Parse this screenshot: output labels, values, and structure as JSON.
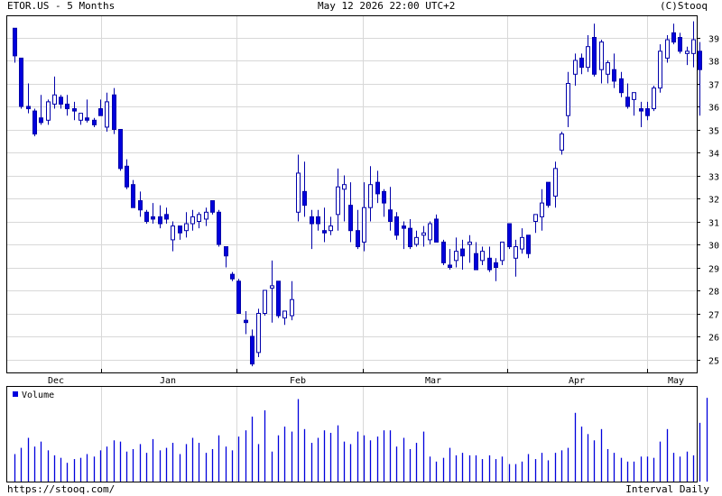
{
  "header": {
    "ticker_label": "ETOR.US - 5 Months",
    "datetime": "May 12 2026 22:00 UTC+2",
    "copyright": "(C)Stooq"
  },
  "footer": {
    "source_url": "https://stooq.com/",
    "interval": "Interval Daily"
  },
  "colors": {
    "bull": "#ffffff",
    "bear": "#0000dd",
    "outline": "#0000aa",
    "volume": "#0000dd",
    "grid": "#d8d8d8"
  },
  "chart_data": [
    {
      "type": "candlestick",
      "ylim": [
        24.3,
        39.7
      ],
      "y_ticks": [
        25,
        26,
        27,
        28,
        29,
        30,
        31,
        32,
        33,
        34,
        35,
        36,
        37,
        38,
        39
      ],
      "x_labels": [
        "Dec",
        "Jan",
        "Feb",
        "Mar",
        "Apr",
        "May"
      ],
      "candles": [
        {
          "o": 39.4,
          "h": 39.4,
          "l": 37.9,
          "c": 38.2
        },
        {
          "o": 38.1,
          "h": 38.1,
          "l": 35.9,
          "c": 36.0
        },
        {
          "o": 36.0,
          "h": 37.0,
          "l": 35.7,
          "c": 35.9
        },
        {
          "o": 35.8,
          "h": 35.9,
          "l": 34.7,
          "c": 34.8
        },
        {
          "o": 35.5,
          "h": 36.5,
          "l": 35.2,
          "c": 35.3
        },
        {
          "o": 35.4,
          "h": 36.3,
          "l": 35.2,
          "c": 36.2
        },
        {
          "o": 36.1,
          "h": 37.3,
          "l": 35.9,
          "c": 36.5
        },
        {
          "o": 36.4,
          "h": 36.5,
          "l": 35.9,
          "c": 36.1
        },
        {
          "o": 36.1,
          "h": 36.5,
          "l": 35.6,
          "c": 35.9
        },
        {
          "o": 35.9,
          "h": 36.2,
          "l": 35.4,
          "c": 35.8
        },
        {
          "o": 35.4,
          "h": 35.7,
          "l": 35.2,
          "c": 35.7
        },
        {
          "o": 35.5,
          "h": 36.3,
          "l": 35.3,
          "c": 35.4
        },
        {
          "o": 35.4,
          "h": 35.5,
          "l": 35.1,
          "c": 35.2
        },
        {
          "o": 35.9,
          "h": 36.3,
          "l": 35.6,
          "c": 35.6
        },
        {
          "o": 35.1,
          "h": 36.6,
          "l": 34.9,
          "c": 36.2
        },
        {
          "o": 36.5,
          "h": 36.8,
          "l": 34.8,
          "c": 35.0
        },
        {
          "o": 35.0,
          "h": 35.0,
          "l": 33.2,
          "c": 33.3
        },
        {
          "o": 33.4,
          "h": 33.7,
          "l": 32.4,
          "c": 32.5
        },
        {
          "o": 32.6,
          "h": 32.8,
          "l": 31.6,
          "c": 31.6
        },
        {
          "o": 31.9,
          "h": 32.3,
          "l": 31.2,
          "c": 31.5
        },
        {
          "o": 31.4,
          "h": 31.5,
          "l": 30.9,
          "c": 31.0
        },
        {
          "o": 31.2,
          "h": 31.8,
          "l": 30.9,
          "c": 31.1
        },
        {
          "o": 31.2,
          "h": 31.7,
          "l": 30.7,
          "c": 30.9
        },
        {
          "o": 31.3,
          "h": 31.6,
          "l": 30.9,
          "c": 31.1
        },
        {
          "o": 30.2,
          "h": 31.0,
          "l": 29.7,
          "c": 30.8
        },
        {
          "o": 30.8,
          "h": 30.8,
          "l": 30.2,
          "c": 30.5
        },
        {
          "o": 30.6,
          "h": 31.4,
          "l": 30.3,
          "c": 30.9
        },
        {
          "o": 30.9,
          "h": 31.5,
          "l": 30.6,
          "c": 31.2
        },
        {
          "o": 31.0,
          "h": 31.4,
          "l": 30.7,
          "c": 31.3
        },
        {
          "o": 31.1,
          "h": 31.6,
          "l": 30.8,
          "c": 31.4
        },
        {
          "o": 31.9,
          "h": 31.9,
          "l": 31.3,
          "c": 31.4
        },
        {
          "o": 31.4,
          "h": 31.5,
          "l": 29.9,
          "c": 30.0
        },
        {
          "o": 29.9,
          "h": 29.9,
          "l": 29.0,
          "c": 29.5
        },
        {
          "o": 28.7,
          "h": 28.8,
          "l": 28.4,
          "c": 28.5
        },
        {
          "o": 28.4,
          "h": 28.5,
          "l": 27.0,
          "c": 27.0
        },
        {
          "o": 26.7,
          "h": 27.1,
          "l": 26.1,
          "c": 26.6
        },
        {
          "o": 26.0,
          "h": 26.3,
          "l": 24.7,
          "c": 24.8
        },
        {
          "o": 25.3,
          "h": 27.2,
          "l": 25.1,
          "c": 27.0
        },
        {
          "o": 27.0,
          "h": 27.8,
          "l": 26.9,
          "c": 28.0
        },
        {
          "o": 28.1,
          "h": 29.3,
          "l": 26.6,
          "c": 28.2
        },
        {
          "o": 28.4,
          "h": 28.4,
          "l": 26.8,
          "c": 26.9
        },
        {
          "o": 26.8,
          "h": 27.1,
          "l": 26.5,
          "c": 27.1
        },
        {
          "o": 26.9,
          "h": 28.4,
          "l": 26.7,
          "c": 27.6
        },
        {
          "o": 31.4,
          "h": 33.9,
          "l": 31.0,
          "c": 33.1
        },
        {
          "o": 32.3,
          "h": 33.6,
          "l": 31.2,
          "c": 31.7
        },
        {
          "o": 31.2,
          "h": 31.5,
          "l": 29.8,
          "c": 30.9
        },
        {
          "o": 31.2,
          "h": 31.5,
          "l": 30.6,
          "c": 30.9
        },
        {
          "o": 30.6,
          "h": 31.6,
          "l": 30.1,
          "c": 30.5
        },
        {
          "o": 30.6,
          "h": 31.2,
          "l": 30.4,
          "c": 30.8
        },
        {
          "o": 31.3,
          "h": 33.3,
          "l": 30.6,
          "c": 32.5
        },
        {
          "o": 32.4,
          "h": 33.0,
          "l": 31.0,
          "c": 32.6
        },
        {
          "o": 31.7,
          "h": 32.7,
          "l": 30.1,
          "c": 30.6
        },
        {
          "o": 30.6,
          "h": 31.5,
          "l": 29.8,
          "c": 29.9
        },
        {
          "o": 30.1,
          "h": 32.7,
          "l": 29.7,
          "c": 31.6
        },
        {
          "o": 31.6,
          "h": 33.4,
          "l": 31.0,
          "c": 32.6
        },
        {
          "o": 32.7,
          "h": 33.2,
          "l": 31.8,
          "c": 32.2
        },
        {
          "o": 32.3,
          "h": 32.4,
          "l": 31.2,
          "c": 31.8
        },
        {
          "o": 31.5,
          "h": 32.5,
          "l": 30.6,
          "c": 31.0
        },
        {
          "o": 31.2,
          "h": 31.4,
          "l": 30.2,
          "c": 30.4
        },
        {
          "o": 30.8,
          "h": 31.0,
          "l": 29.8,
          "c": 30.7
        },
        {
          "o": 30.7,
          "h": 31.1,
          "l": 29.8,
          "c": 29.9
        },
        {
          "o": 30.0,
          "h": 30.6,
          "l": 29.9,
          "c": 30.3
        },
        {
          "o": 30.4,
          "h": 30.8,
          "l": 29.9,
          "c": 30.5
        },
        {
          "o": 30.2,
          "h": 31.0,
          "l": 30.0,
          "c": 30.9
        },
        {
          "o": 31.1,
          "h": 31.3,
          "l": 30.1,
          "c": 30.1
        },
        {
          "o": 30.1,
          "h": 30.2,
          "l": 29.1,
          "c": 29.2
        },
        {
          "o": 29.1,
          "h": 29.8,
          "l": 28.9,
          "c": 29.0
        },
        {
          "o": 29.3,
          "h": 30.3,
          "l": 29.0,
          "c": 29.7
        },
        {
          "o": 29.8,
          "h": 30.2,
          "l": 28.9,
          "c": 29.5
        },
        {
          "o": 30.0,
          "h": 30.4,
          "l": 29.2,
          "c": 30.1
        },
        {
          "o": 29.6,
          "h": 30.1,
          "l": 28.9,
          "c": 28.9
        },
        {
          "o": 29.3,
          "h": 29.9,
          "l": 29.1,
          "c": 29.7
        },
        {
          "o": 29.4,
          "h": 29.9,
          "l": 28.8,
          "c": 28.9
        },
        {
          "o": 29.2,
          "h": 29.4,
          "l": 28.4,
          "c": 29.0
        },
        {
          "o": 29.3,
          "h": 30.1,
          "l": 29.1,
          "c": 30.1
        },
        {
          "o": 30.9,
          "h": 30.9,
          "l": 29.8,
          "c": 29.9
        },
        {
          "o": 29.4,
          "h": 30.2,
          "l": 28.6,
          "c": 29.9
        },
        {
          "o": 29.8,
          "h": 30.7,
          "l": 29.6,
          "c": 30.3
        },
        {
          "o": 30.4,
          "h": 30.4,
          "l": 29.4,
          "c": 29.6
        },
        {
          "o": 31.0,
          "h": 31.2,
          "l": 30.5,
          "c": 31.3
        },
        {
          "o": 31.2,
          "h": 32.4,
          "l": 30.6,
          "c": 31.8
        },
        {
          "o": 32.7,
          "h": 32.7,
          "l": 31.6,
          "c": 31.7
        },
        {
          "o": 32.1,
          "h": 33.6,
          "l": 31.6,
          "c": 33.3
        },
        {
          "o": 34.1,
          "h": 34.9,
          "l": 33.9,
          "c": 34.8
        },
        {
          "o": 35.6,
          "h": 37.5,
          "l": 35.1,
          "c": 37.0
        },
        {
          "o": 37.4,
          "h": 38.3,
          "l": 36.9,
          "c": 38.0
        },
        {
          "o": 38.1,
          "h": 38.3,
          "l": 37.4,
          "c": 37.7
        },
        {
          "o": 37.7,
          "h": 39.1,
          "l": 37.5,
          "c": 38.6
        },
        {
          "o": 39.0,
          "h": 39.6,
          "l": 37.3,
          "c": 37.4
        },
        {
          "o": 37.6,
          "h": 38.9,
          "l": 37.0,
          "c": 38.8
        },
        {
          "o": 37.4,
          "h": 38.0,
          "l": 37.0,
          "c": 37.9
        },
        {
          "o": 37.6,
          "h": 38.3,
          "l": 36.8,
          "c": 37.1
        },
        {
          "o": 37.2,
          "h": 37.5,
          "l": 36.4,
          "c": 36.6
        },
        {
          "o": 36.4,
          "h": 37.0,
          "l": 35.9,
          "c": 36.0
        },
        {
          "o": 36.3,
          "h": 36.6,
          "l": 35.6,
          "c": 36.6
        },
        {
          "o": 35.9,
          "h": 36.2,
          "l": 35.1,
          "c": 35.8
        },
        {
          "o": 35.9,
          "h": 36.2,
          "l": 35.4,
          "c": 35.6
        },
        {
          "o": 35.9,
          "h": 36.9,
          "l": 35.8,
          "c": 36.8
        },
        {
          "o": 36.8,
          "h": 38.7,
          "l": 36.6,
          "c": 38.4
        },
        {
          "o": 38.1,
          "h": 39.1,
          "l": 37.9,
          "c": 38.9
        },
        {
          "o": 39.2,
          "h": 39.6,
          "l": 38.7,
          "c": 38.8
        },
        {
          "o": 39.0,
          "h": 39.2,
          "l": 38.3,
          "c": 38.4
        },
        {
          "o": 38.3,
          "h": 38.6,
          "l": 37.8,
          "c": 38.4
        },
        {
          "o": 38.3,
          "h": 39.7,
          "l": 37.7,
          "c": 38.9
        },
        {
          "o": 38.4,
          "h": 38.8,
          "l": 35.6,
          "c": 37.6
        }
      ]
    },
    {
      "type": "bar",
      "legend": "Volume",
      "values": [
        22,
        27,
        35,
        28,
        32,
        25,
        21,
        19,
        15,
        18,
        19,
        22,
        20,
        25,
        28,
        33,
        32,
        24,
        26,
        30,
        23,
        34,
        25,
        27,
        31,
        22,
        30,
        35,
        31,
        23,
        26,
        37,
        28,
        25,
        36,
        41,
        52,
        30,
        57,
        24,
        37,
        44,
        40,
        66,
        42,
        31,
        35,
        41,
        39,
        45,
        32,
        30,
        40,
        37,
        33,
        36,
        41,
        41,
        28,
        35,
        26,
        31,
        40,
        20,
        16,
        19,
        27,
        21,
        23,
        21,
        21,
        18,
        21,
        18,
        20,
        14,
        14,
        16,
        22,
        18,
        23,
        17,
        23,
        25,
        27,
        55,
        44,
        38,
        33,
        42,
        26,
        23,
        19,
        16,
        16,
        20,
        20,
        19,
        32,
        42,
        23,
        20,
        24,
        21,
        47,
        67
      ]
    }
  ]
}
